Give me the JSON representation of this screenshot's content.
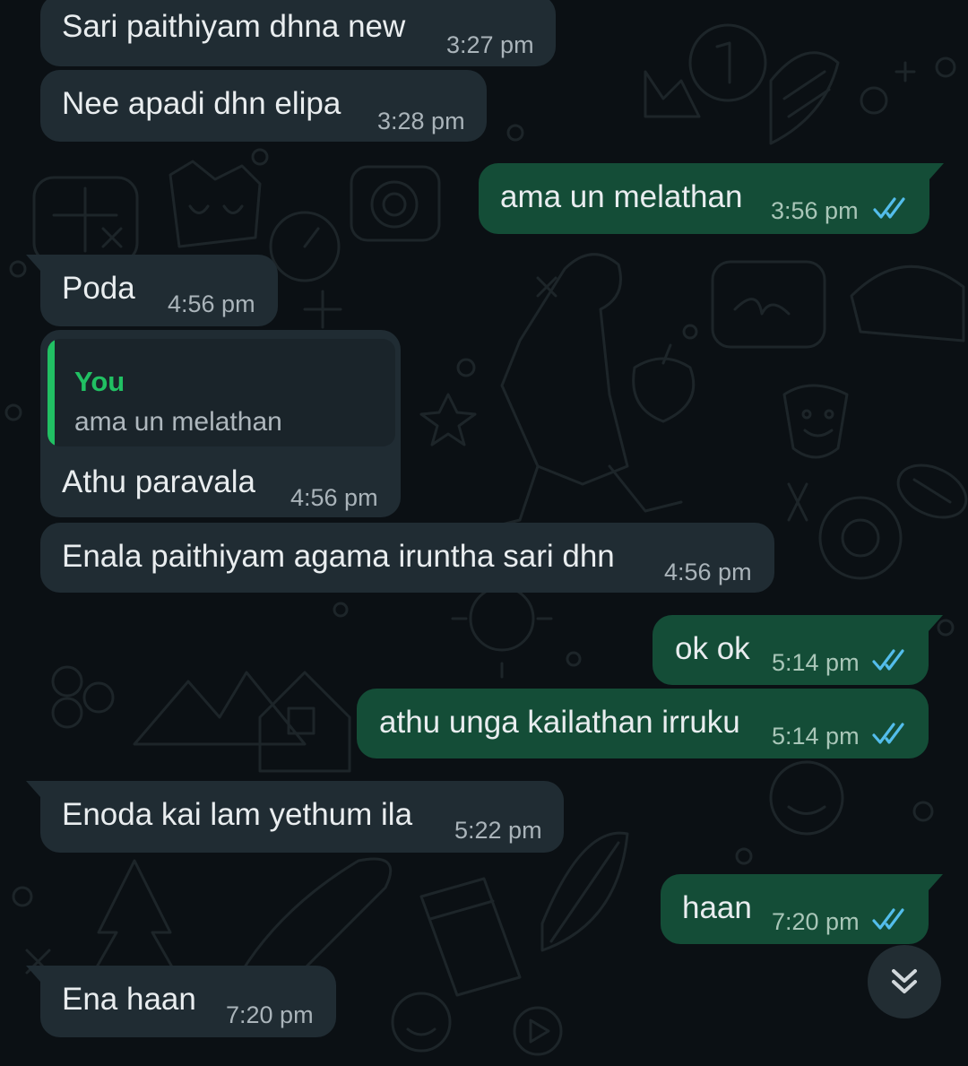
{
  "messages": [
    {
      "id": "m1",
      "direction": "in",
      "text": "Sari paithiyam dhna new",
      "time": "3:27 pm"
    },
    {
      "id": "m2",
      "direction": "in",
      "text": "Nee apadi dhn elipa",
      "time": "3:28 pm"
    },
    {
      "id": "m3",
      "direction": "out",
      "text": "ama un melathan",
      "time": "3:56 pm",
      "status": "read"
    },
    {
      "id": "m4",
      "direction": "in",
      "text": "Poda",
      "time": "4:56 pm"
    },
    {
      "id": "m5",
      "direction": "in",
      "text": "Athu paravala",
      "time": "4:56 pm",
      "reply": {
        "author": "You",
        "text": "ama un melathan"
      }
    },
    {
      "id": "m6",
      "direction": "in",
      "text": "Enala paithiyam agama iruntha sari dhn",
      "time": "4:56 pm"
    },
    {
      "id": "m7",
      "direction": "out",
      "text": "ok ok",
      "time": "5:14 pm",
      "status": "read"
    },
    {
      "id": "m8",
      "direction": "out",
      "text": "athu unga kailathan irruku",
      "time": "5:14 pm",
      "status": "read"
    },
    {
      "id": "m9",
      "direction": "in",
      "text": "Enoda kai lam yethum ila",
      "time": "5:22 pm"
    },
    {
      "id": "m10",
      "direction": "out",
      "text": "haan",
      "time": "7:20 pm",
      "status": "read"
    },
    {
      "id": "m11",
      "direction": "in",
      "text": "Ena haan",
      "time": "7:20 pm"
    }
  ],
  "controls": {
    "scroll_to_bottom_icon": "double-chevron-down-icon"
  },
  "colors": {
    "background": "#0b1014",
    "incoming_bubble": "#202c33",
    "outgoing_bubble": "#144d37",
    "read_ticks": "#53bdeb",
    "reply_accent": "#21c063"
  }
}
